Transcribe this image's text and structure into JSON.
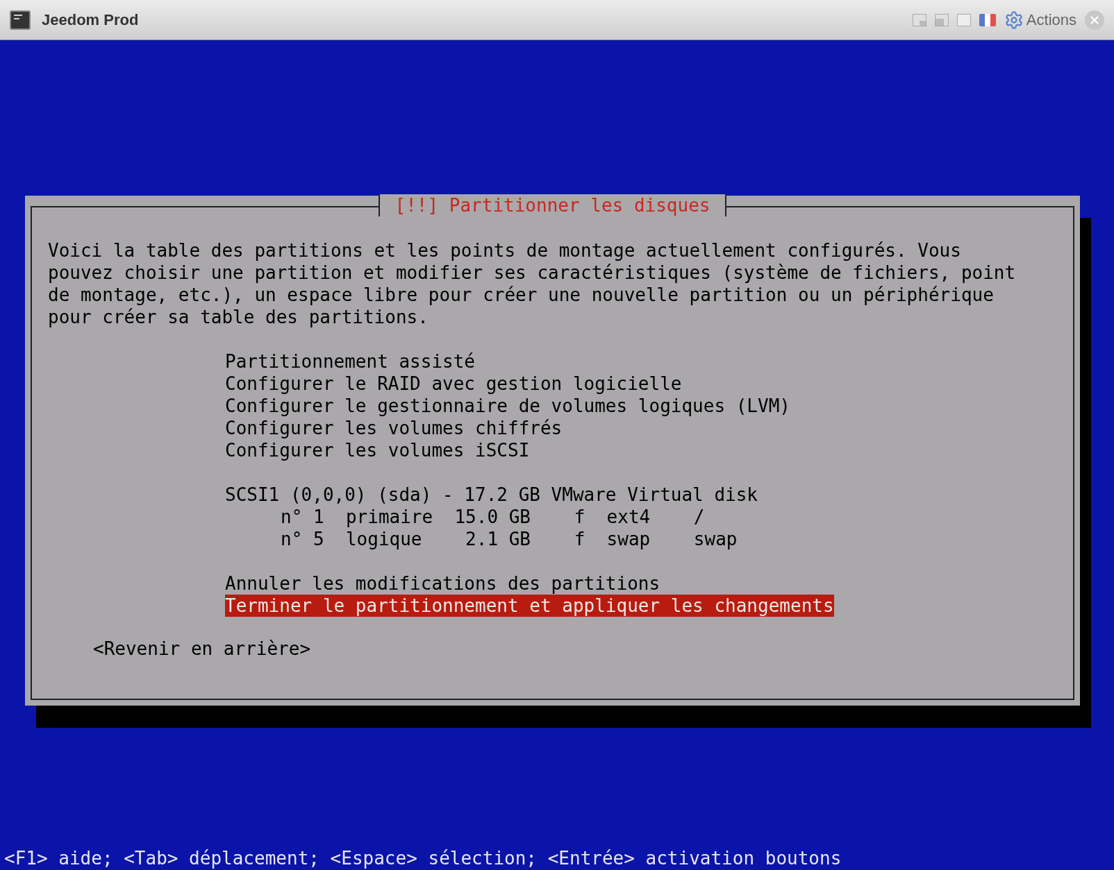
{
  "window": {
    "title": "Jeedom Prod",
    "actions_label": "Actions"
  },
  "dialog": {
    "title": "[!!] Partitionner les disques",
    "description": "Voici la table des partitions et les points de montage actuellement configurés. Vous pouvez choisir une partition et modifier ses caractéristiques (système de fichiers, point de montage, etc.), un espace libre pour créer une nouvelle partition ou un périphérique pour créer sa table des partitions.",
    "groups": [
      [
        {
          "kind": "action",
          "label": "Partitionnement assisté",
          "selected": false
        },
        {
          "kind": "action",
          "label": "Configurer le RAID avec gestion logicielle",
          "selected": false
        },
        {
          "kind": "action",
          "label": "Configurer le gestionnaire de volumes logiques (LVM)",
          "selected": false
        },
        {
          "kind": "action",
          "label": "Configurer les volumes chiffrés",
          "selected": false
        },
        {
          "kind": "action",
          "label": "Configurer les volumes iSCSI",
          "selected": false
        }
      ],
      [
        {
          "kind": "disk",
          "label": "SCSI1 (0,0,0) (sda) - 17.2 GB VMware Virtual disk",
          "selected": false
        },
        {
          "kind": "partition",
          "label": "n° 1  primaire  15.0 GB    f  ext4    /",
          "selected": false
        },
        {
          "kind": "partition",
          "label": "n° 5  logique    2.1 GB    f  swap    swap",
          "selected": false
        }
      ],
      [
        {
          "kind": "action",
          "label": "Annuler les modifications des partitions",
          "selected": false
        },
        {
          "kind": "action",
          "label": "Terminer le partitionnement et appliquer les changements",
          "selected": true
        }
      ]
    ],
    "back_button": "<Revenir en arrière>"
  },
  "status_bar": "<F1> aide; <Tab> déplacement; <Espace> sélection; <Entrée> activation boutons"
}
